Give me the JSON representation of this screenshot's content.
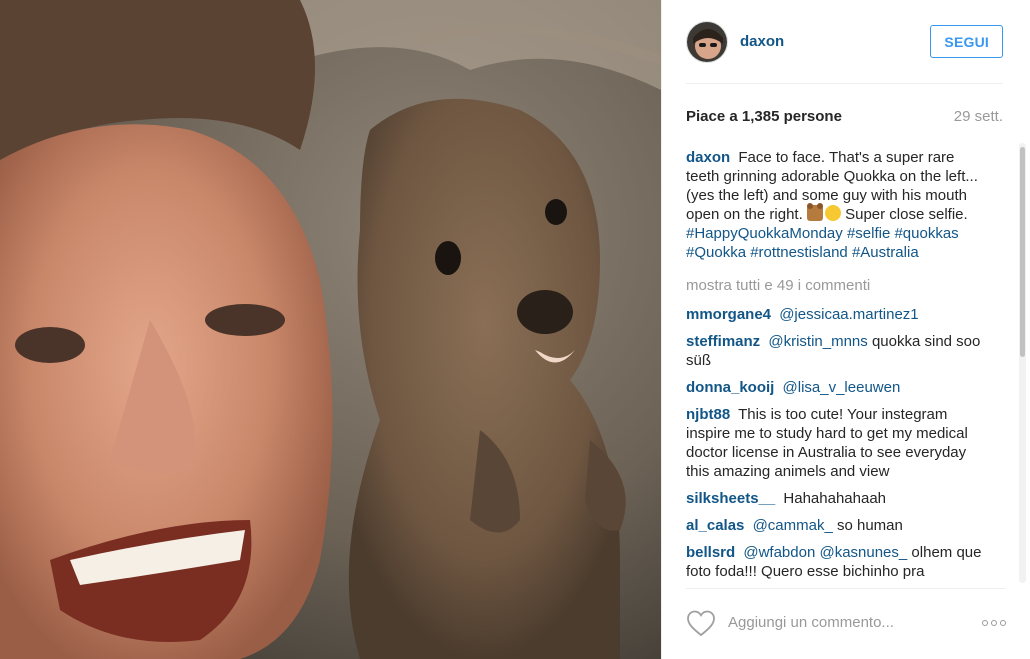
{
  "post": {
    "author": {
      "username": "daxon",
      "avatar_icon": "profile-avatar"
    },
    "follow_label": "SEGUI",
    "likes_text": "Piace a 1,385 persone",
    "date": "29 sett.",
    "caption": {
      "user": "daxon",
      "text": "Face to face. That's a super rare teeth grinning adorable Quokka on the left... (yes the left) and some guy with his mouth open on the right.",
      "text_after_emoji": "Super close selfie.",
      "emojis": [
        "bear-face",
        "smiling-face"
      ],
      "hashtags": [
        "#HappyQuokkaMonday",
        "#selfie",
        "#quokkas",
        "#Quokka",
        "#rottnestisland",
        "#Australia"
      ]
    },
    "load_more": "mostra tutti e 49 i commenti",
    "comments": [
      {
        "user": "mmorgane4",
        "mention": "@jessicaa.martinez1",
        "text": ""
      },
      {
        "user": "steffimanz",
        "mention": "@kristin_mnns",
        "text": "quokka sind soo süß"
      },
      {
        "user": "donna_kooij",
        "mention": "@lisa_v_leeuwen",
        "text": ""
      },
      {
        "user": "njbt88",
        "mention": "",
        "text": "This is too cute! Your instegram inspire me to study hard to get my medical doctor license in Australia to see everyday this amazing animels and view"
      },
      {
        "user": "silksheets__",
        "mention": "",
        "text": "Hahahahahaah"
      },
      {
        "user": "al_calas",
        "mention": "@cammak_",
        "text": "so human"
      },
      {
        "user": "bellsrd",
        "mention": "@wfabdon @kasnunes_",
        "text": "olhem que foto foda!!! Quero esse bichinho pra"
      }
    ],
    "comment_placeholder": "Aggiungi un commento...",
    "icons": {
      "like": "heart-outline-icon",
      "options": "more-options-icon"
    },
    "colors": {
      "link": "#125688",
      "follow": "#3897f0",
      "muted": "#999999"
    }
  }
}
